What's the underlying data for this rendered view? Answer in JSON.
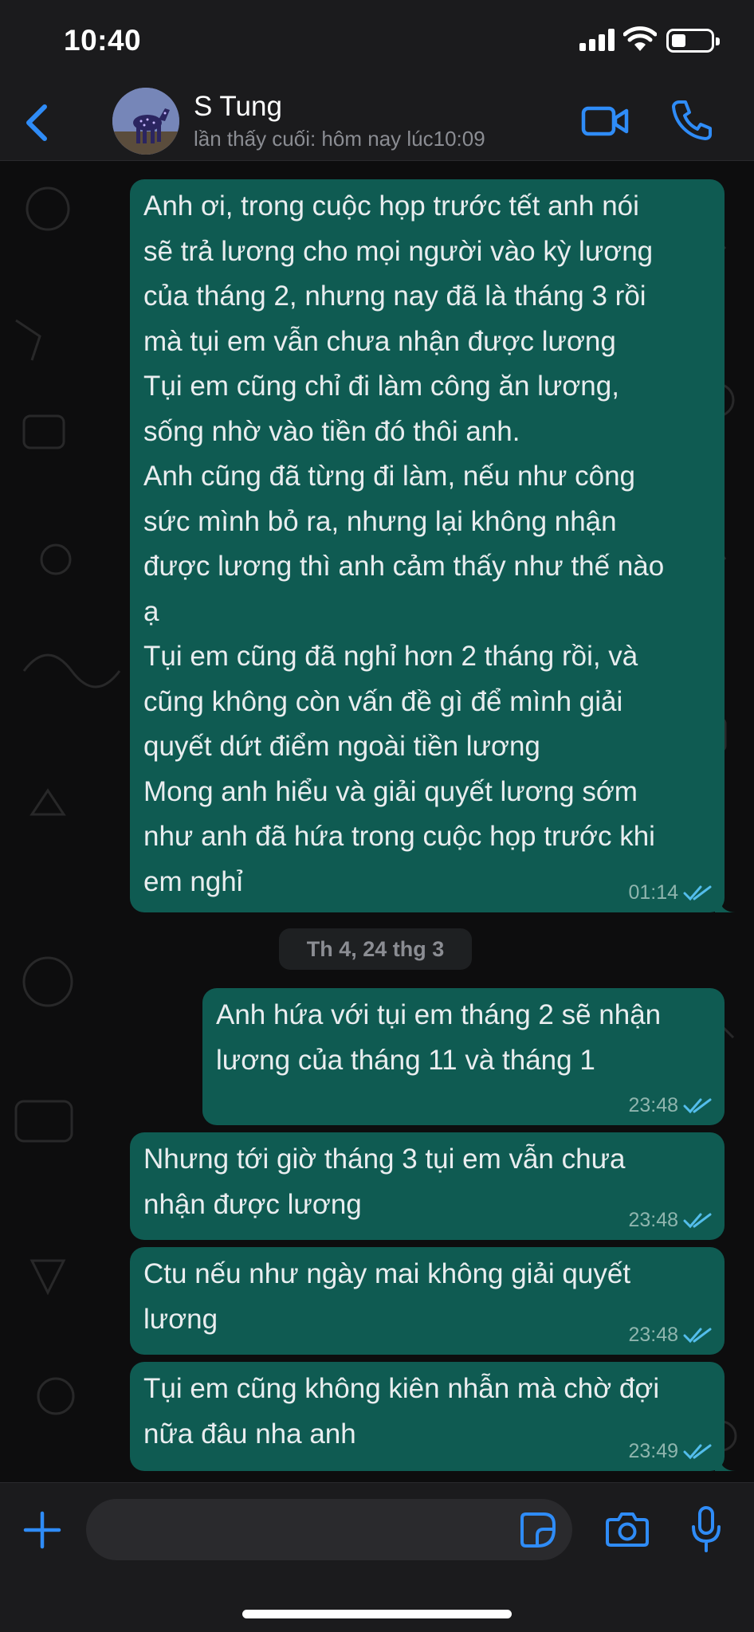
{
  "status_bar": {
    "time": "10:40",
    "icons": [
      "signal-icon",
      "wifi-icon",
      "battery-icon"
    ]
  },
  "header": {
    "back_icon": "chevron-left-icon",
    "contact_name": "S Tung",
    "last_seen": "lần thấy cuối: hôm nay lúc10:09",
    "video_icon": "video-camera-icon",
    "phone_icon": "phone-icon"
  },
  "colors": {
    "accent": "#2f8cf7",
    "outgoing_bubble": "#0f5b52",
    "background": "#0d0d0e",
    "bar": "#1b1b1d",
    "read_ticks": "#53bdeb"
  },
  "messages": [
    {
      "text": "Anh ơi, trong cuộc họp trước tết anh nói\nsẽ trả lương cho mọi người vào kỳ lương\ncủa tháng 2, nhưng nay đã là tháng 3 rồi\nmà tụi em vẫn chưa nhận được lương\nTụi em cũng chỉ đi làm công ăn lương,\nsống nhờ vào tiền đó thôi anh.\nAnh cũng đã từng đi làm, nếu như công\nsức mình bỏ ra, nhưng lại không nhận\nđược lương thì anh cảm thấy như thế nào\nạ\nTụi em cũng đã nghỉ hơn 2 tháng rồi, và\ncũng không còn vấn đề gì để mình giải\nquyết dứt điểm ngoài tiền lương\nMong anh hiểu và giải quyết lương sớm\nnhư anh đã hứa trong cuộc họp trước khi\nem nghỉ",
      "time": "01:14",
      "status": "read"
    },
    {
      "text": "Anh hứa với tụi em tháng 2 sẽ nhận\nlương của tháng 11 và tháng 1",
      "time": "23:48",
      "status": "read"
    },
    {
      "text": "Nhưng tới giờ tháng 3 tụi em vẫn chưa\nnhận được lương",
      "time": "23:48",
      "status": "read"
    },
    {
      "text": "Ctu nếu như ngày mai không giải quyết\nlương",
      "time": "23:48",
      "status": "read"
    },
    {
      "text": "Tụi em cũng không kiên nhẫn mà chờ đợi\nnữa đâu nha anh",
      "time": "23:49",
      "status": "read"
    }
  ],
  "date_separator": "Th 4, 24 thg 3",
  "input_bar": {
    "plus_icon": "plus-icon",
    "input_value": "",
    "sticker_icon": "sticker-icon",
    "camera_icon": "camera-icon",
    "mic_icon": "microphone-icon"
  }
}
